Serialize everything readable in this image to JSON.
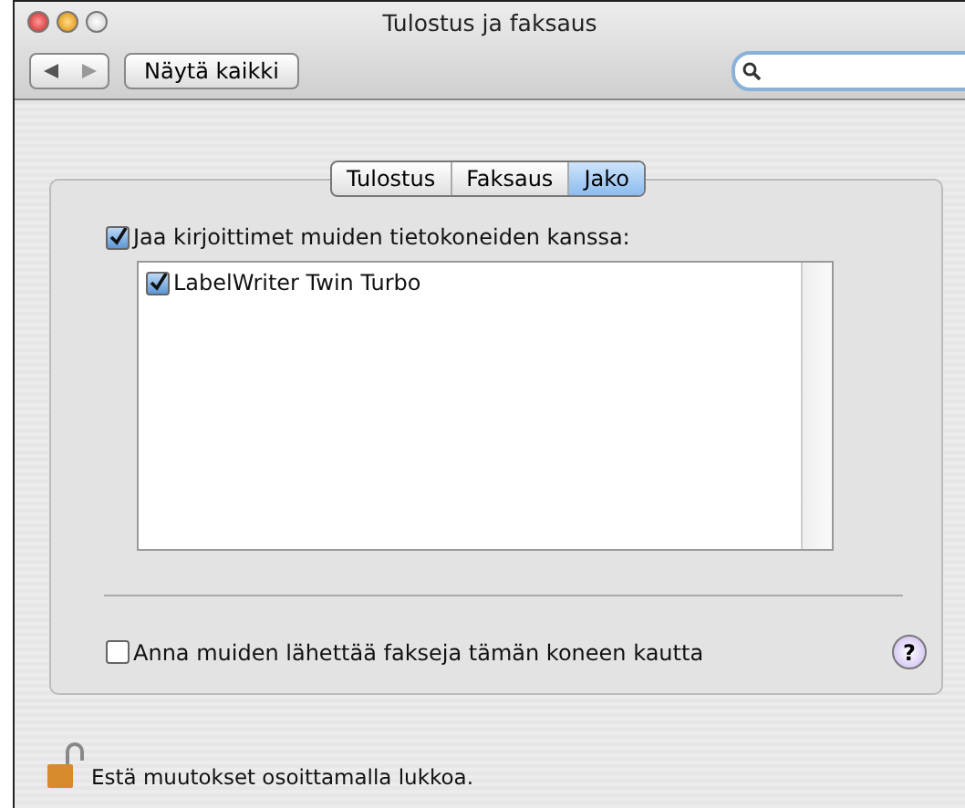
{
  "window": {
    "title": "Tulostus ja faksaus"
  },
  "toolbar": {
    "show_all": "Näytä kaikki"
  },
  "tabs": [
    {
      "label": "Tulostus",
      "selected": false
    },
    {
      "label": "Faksaus",
      "selected": false
    },
    {
      "label": "Jako",
      "selected": true
    }
  ],
  "share_printers": {
    "label": "Jaa kirjoittimet muiden tietokoneiden kanssa:",
    "checked": true
  },
  "printers": [
    {
      "name": "LabelWriter Twin Turbo",
      "checked": true
    }
  ],
  "allow_fax": {
    "label": "Anna muiden lähettää fakseja tämän koneen kautta",
    "checked": false
  },
  "help": "?",
  "lock_text": "Estä muutokset osoittamalla lukkoa."
}
